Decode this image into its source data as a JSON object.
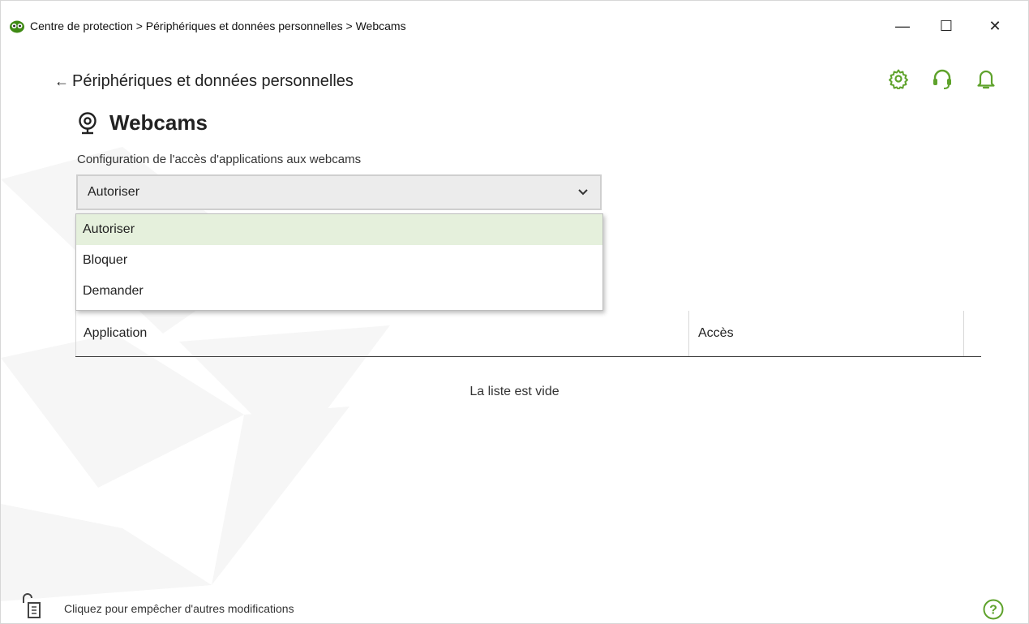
{
  "titlebar": {
    "title": "Centre de protection > Périphériques et données personnelles > Webcams",
    "minimize": "—",
    "maximize": "☐",
    "close": "✕"
  },
  "header": {
    "back_label": "Périphériques et données personnelles",
    "back_arrow": "←",
    "icons": [
      "gear-icon",
      "headset-support-icon",
      "bell-icon"
    ],
    "accent_color": "#6aab2e"
  },
  "page": {
    "title": "Webcams",
    "icon": "webcam-icon",
    "description": "Configuration de l'accès d'applications aux webcams"
  },
  "access_select": {
    "value": "Autoriser",
    "options": [
      "Autoriser",
      "Bloquer",
      "Demander"
    ],
    "highlighted_option": "Autoriser",
    "highlight_color": "#e5f0dc"
  },
  "table": {
    "columns": [
      "Application",
      "Accès"
    ],
    "rows": [],
    "empty_text": "La liste est vide"
  },
  "footer": {
    "lock_text": "Cliquez pour empêcher d'autres modifications",
    "help": "?"
  }
}
